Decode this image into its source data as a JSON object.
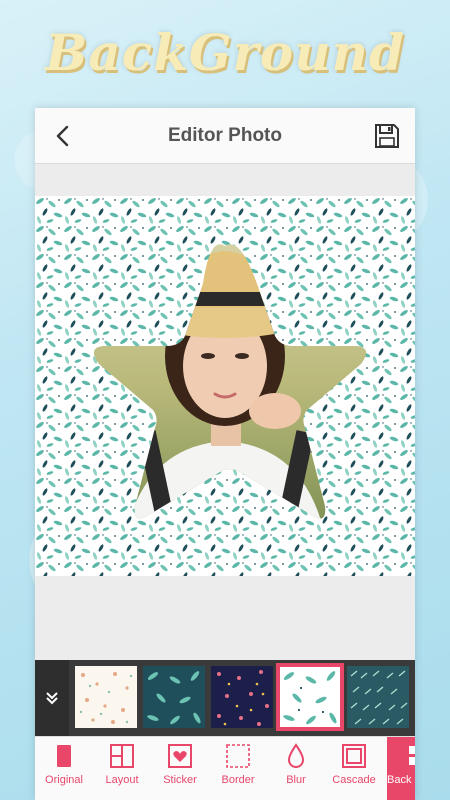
{
  "banner": {
    "title": "BackGround"
  },
  "header": {
    "title": "Editor Photo"
  },
  "thumbnails": [
    {
      "name": "pattern-floral-dots"
    },
    {
      "name": "pattern-leaves-teal-dark"
    },
    {
      "name": "pattern-navy-floral"
    },
    {
      "name": "pattern-leaves-teal-white",
      "selected": true
    },
    {
      "name": "pattern-leaves-dark-teal"
    }
  ],
  "toolbar": {
    "original": "Original",
    "layout": "Layout",
    "sticker": "Sticker",
    "border": "Border",
    "blur": "Blur",
    "cascade": "Cascade",
    "back": "Back"
  },
  "colors": {
    "accent": "#e8476a",
    "title": "#f7ecb8",
    "leaf_teal": "#5bb7a8",
    "leaf_dark": "#1f4f5a"
  }
}
